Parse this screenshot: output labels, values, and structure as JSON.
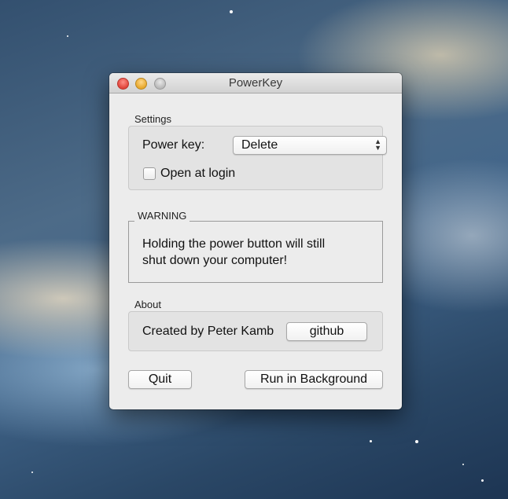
{
  "window": {
    "title": "PowerKey"
  },
  "settings": {
    "label": "Settings",
    "power_key_label": "Power key:",
    "power_key_value": "Delete",
    "open_at_login_label": "Open at login",
    "open_at_login_checked": false
  },
  "warning": {
    "label": "WARNING",
    "line1": "Holding the power button will still",
    "line2": "shut down your computer!"
  },
  "about": {
    "label": "About",
    "created_by": "Created by Peter Kamb",
    "github_button": "github"
  },
  "footer": {
    "quit_button": "Quit",
    "run_background_button": "Run in Background"
  },
  "icons": {
    "popup_arrows": "up-down-chevron-icon",
    "close": "close-button-red",
    "minimize": "minimize-button-yellow",
    "zoom": "zoom-button-gray"
  }
}
